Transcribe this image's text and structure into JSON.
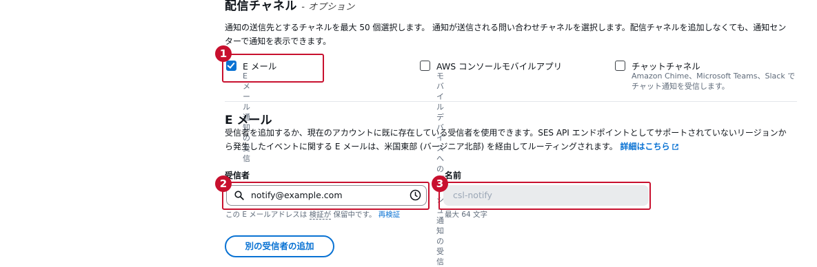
{
  "channels": {
    "title": "配信チャネル",
    "optional": "- オプション",
    "description": "通知の送信先とするチャネルを最大 50 個選択します。 通知が送信される問い合わせチャネルを選択します。配信チャネルを追加しなくても、通知センターで通知を表示できます。",
    "items": [
      {
        "label": "E メール",
        "sub": "E メール通知の受信",
        "checked": true
      },
      {
        "label": "AWS コンソールモバイルアプリ",
        "sub": "モバイルデバイスへのプッシュ通知の受信",
        "checked": false
      },
      {
        "label": "チャットチャネル",
        "sub": "Amazon Chime、Microsoft Teams、Slack でチャット通知を受信します。",
        "checked": false
      }
    ]
  },
  "email": {
    "title": "E メール",
    "description": "受信者を追加するか、現在のアカウントに既に存在している受信者を使用できます。SES API エンドポイントとしてサポートされていないリージョンから発生したイベントに関する E メールは、米国東部 (バージニア北部) を経由してルーティングされます。",
    "details_link": "詳細はこちら",
    "recipient_label": "受信者",
    "recipient_value": "notify@example.com",
    "name_label": "名前",
    "name_placeholder": "csl-notify",
    "hint_prefix": "この E メールアドレスは",
    "hint_verify": "検証が",
    "hint_suffix": "保留中です。",
    "reverify_link": "再検証",
    "name_hint": "最大 64 文字",
    "add_button": "別の受信者の追加"
  },
  "annotations": [
    "1",
    "2",
    "3"
  ],
  "colors": {
    "accent": "#0972d3",
    "highlight": "#c8102e"
  }
}
